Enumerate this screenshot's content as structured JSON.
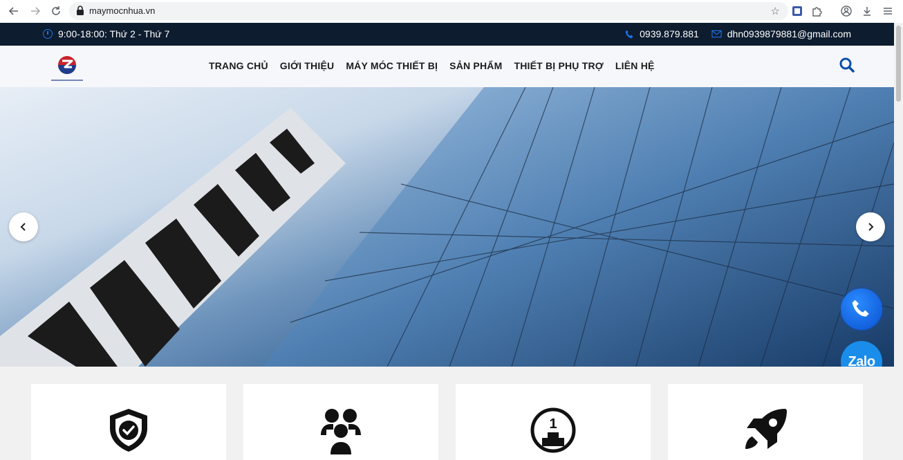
{
  "browser": {
    "url": "maymocnhua.vn"
  },
  "topbar": {
    "hours": "9:00-18:00: Thứ 2 - Thứ 7",
    "phone": "0939.879.881",
    "email": "dhn0939879881@gmail.com"
  },
  "header": {
    "logo_icon": "company-logo",
    "menu": [
      "TRANG CHỦ",
      "GIỚI THIỆU",
      "MÁY MÓC THIẾT BỊ",
      "SẢN PHẨM",
      "THIẾT BỊ PHỤ TRỢ",
      "LIÊN HỆ"
    ],
    "search_icon": "search-icon"
  },
  "slider": {
    "image": "glass-skyscraper-photo",
    "prev_icon": "chevron-left-icon",
    "next_icon": "chevron-right-icon"
  },
  "floating": {
    "phone_icon": "phone-icon",
    "zalo_label": "Zalo"
  },
  "features": {
    "icons": [
      "shield-check-icon",
      "people-group-icon",
      "ranking-first-icon",
      "rocket-icon"
    ]
  },
  "colors": {
    "topbar_bg": "#0e1c2f",
    "accent_blue": "#1a73e8",
    "header_bg": "#f6f7fb",
    "search_blue": "#0a4ea8"
  }
}
